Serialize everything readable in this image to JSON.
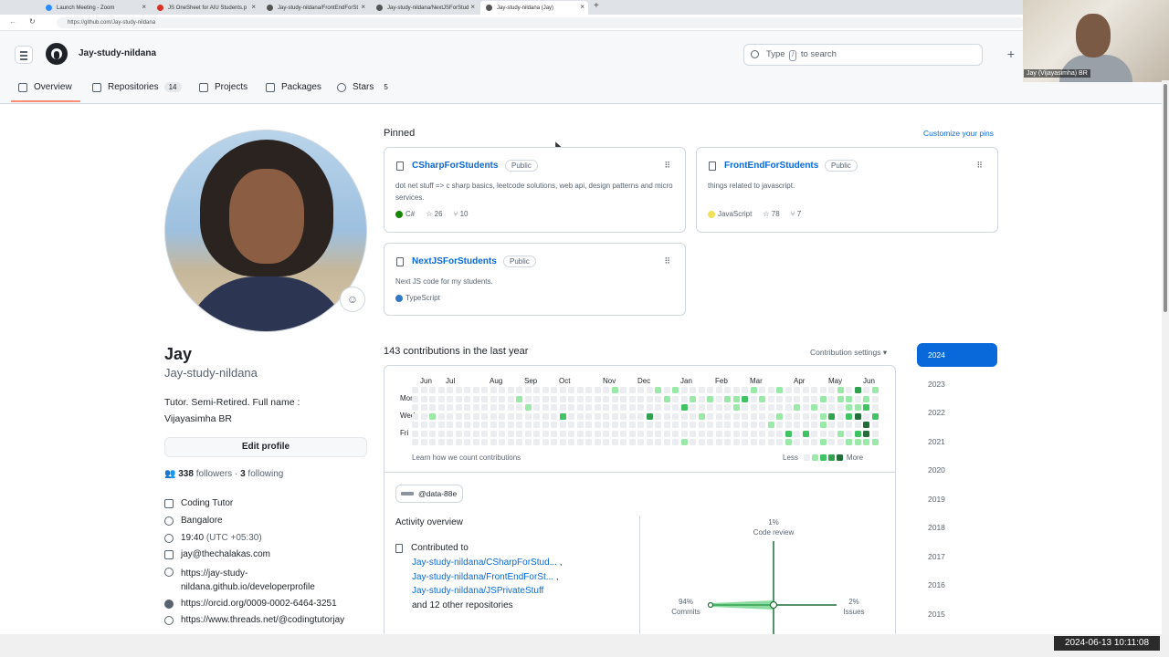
{
  "browser": {
    "tabs": [
      {
        "label": "Launch Meeting - Zoom"
      },
      {
        "label": "JS OneSheet for AIU Students.p"
      },
      {
        "label": "Jay-study-nildana/FrontEndForSt"
      },
      {
        "label": "Jay-study-nildana/NextJSForStud"
      },
      {
        "label": "Jay-study-nildana (Jay)"
      }
    ],
    "new_tab": "+",
    "url": "https://github.com/Jay-study-nildana"
  },
  "header": {
    "username": "Jay-study-nildana",
    "search_prefix": "Type",
    "search_key": "/",
    "search_suffix": "to search",
    "plus": "+",
    "nav": [
      {
        "label": "Overview",
        "icon": "book-open-icon"
      },
      {
        "label": "Repositories",
        "count": "14",
        "icon": "repo-icon"
      },
      {
        "label": "Projects",
        "icon": "table-icon"
      },
      {
        "label": "Packages",
        "icon": "package-icon"
      },
      {
        "label": "Stars",
        "count": "5",
        "icon": "star-icon"
      }
    ]
  },
  "webcam": {
    "name": "Jay (Vijayasimha) BR"
  },
  "profile": {
    "name": "Jay",
    "login": "Jay-study-nildana",
    "bio": "Tutor. Semi-Retired. Full name : Vijayasimha BR",
    "edit_label": "Edit profile",
    "followers": "338",
    "followers_label": "followers",
    "dot": "·",
    "following": "3",
    "following_label": "following",
    "details": [
      {
        "icon": "organization-icon",
        "text": "Coding Tutor"
      },
      {
        "icon": "location-icon",
        "text": "Bangalore"
      },
      {
        "icon": "clock-icon",
        "time": "19:40",
        "tz": "(UTC +05:30)"
      },
      {
        "icon": "mail-icon",
        "text": "jay@thechalakas.com"
      },
      {
        "icon": "link-icon",
        "text": "https://jay-study-",
        "text2": "nildana.github.io/developerprofile"
      },
      {
        "icon": "orcid-icon",
        "text": "https://orcid.org/0009-0002-6464-3251"
      },
      {
        "icon": "link-icon",
        "text": "https://www.threads.net/@codingtutorjay"
      }
    ]
  },
  "pinned": {
    "title": "Pinned",
    "customize": "Customize your pins",
    "cards": [
      {
        "title": "CSharpForStudents",
        "visibility": "Public",
        "desc": "dot net stuff => c sharp basics, leetcode solutions, web api, design patterns and micro services.",
        "lang": "C#",
        "lang_color": "#178600",
        "stars": "26",
        "forks": "10"
      },
      {
        "title": "FrontEndForStudents",
        "visibility": "Public",
        "desc": "things related to javascript.",
        "lang": "JavaScript",
        "lang_color": "#f1e05a",
        "stars": "78",
        "forks": "7"
      },
      {
        "title": "NextJSForStudents",
        "visibility": "Public",
        "desc": "Next JS code for my students.",
        "lang": "TypeScript",
        "lang_color": "#3178c6"
      }
    ]
  },
  "contributions": {
    "title": "143 contributions in the last year",
    "settings": "Contribution settings ▾",
    "months": [
      "Jun",
      "Jul",
      "Aug",
      "Sep",
      "Oct",
      "Nov",
      "Dec",
      "Jan",
      "Feb",
      "Mar",
      "Apr",
      "May",
      "Jun"
    ],
    "days": [
      "Mon",
      "Wed",
      "Fri"
    ],
    "learn": "Learn how we count contributions",
    "less": "Less",
    "more": "More",
    "colors": [
      "#ebedf0",
      "#9be9a8",
      "#40c463",
      "#30a14e",
      "#216e39"
    ]
  },
  "activity": {
    "org": "@data-88e",
    "title": "Activity overview",
    "contributed_to": "Contributed to",
    "repos": [
      {
        "name": "Jay-study-nildana/CSharpForStud...",
        "sep": ","
      },
      {
        "name": "Jay-study-nildana/FrontEndForSt...",
        "sep": ","
      },
      {
        "name": "Jay-study-nildana/JSPrivateStuff",
        "sep": ""
      }
    ],
    "others": "and 12 other repositories",
    "chart": {
      "code_review_pct": "1%",
      "code_review_label": "Code review",
      "commits_pct": "94%",
      "commits_label": "Commits",
      "issues_pct": "2%",
      "issues_label": "Issues"
    }
  },
  "years": [
    "2024",
    "2023",
    "2022",
    "2021",
    "2020",
    "2019",
    "2018",
    "2017",
    "2016",
    "2015"
  ],
  "timestamp": "2024-06-13 10:11:08"
}
